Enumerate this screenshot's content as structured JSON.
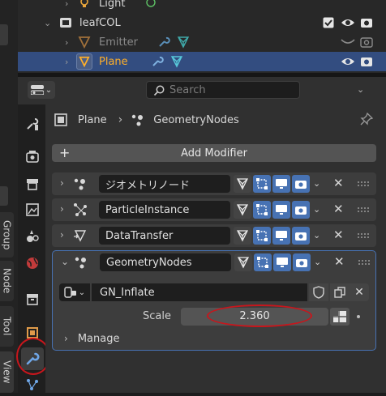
{
  "outliner": {
    "rows": [
      {
        "label": "Light"
      },
      {
        "label": "leafCOL"
      },
      {
        "label": "Emitter"
      },
      {
        "label": "Plane"
      }
    ]
  },
  "side_tabs": [
    "Group",
    "Node",
    "Tool",
    "View"
  ],
  "header": {
    "search_placeholder": "Search"
  },
  "breadcrumb": {
    "object": "Plane",
    "modifier": "GeometryNodes"
  },
  "add_modifier_label": "Add Modifier",
  "modifiers": [
    {
      "name": "ジオメトリノード",
      "icon": "geometry-nodes-icon"
    },
    {
      "name": "ParticleInstance",
      "icon": "particle-instance-icon"
    },
    {
      "name": "DataTransfer",
      "icon": "data-transfer-icon"
    },
    {
      "name": "GeometryNodes",
      "icon": "geometry-nodes-icon"
    }
  ],
  "node_group": {
    "name": "GN_Inflate"
  },
  "inputs": {
    "scale_label": "Scale",
    "scale_value": "2.360"
  },
  "manage_label": "Manage",
  "colors": {
    "accent_blue": "#4772b3",
    "selected_row": "#334d80",
    "highlight_red": "#c7161c",
    "object_orange": "#ffaf29",
    "modifier_cyan": "#57c8d9"
  }
}
